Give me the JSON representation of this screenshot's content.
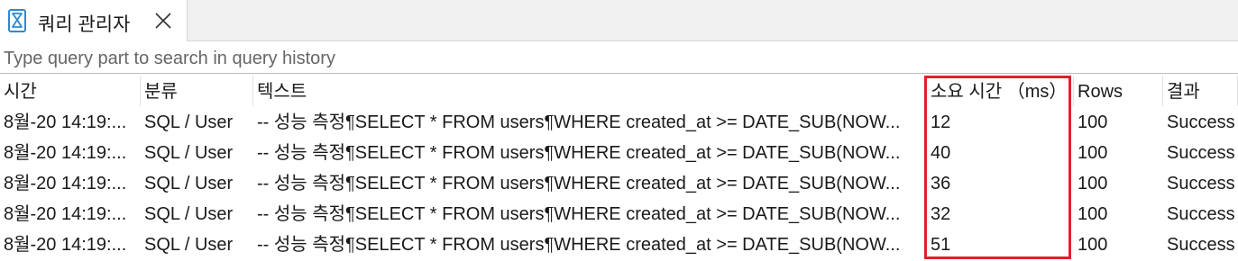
{
  "tab": {
    "title": "쿼리 관리자",
    "icon": "hourglass-icon",
    "close_icon": "close-icon"
  },
  "search": {
    "placeholder": "Type query part to search in query history",
    "value": ""
  },
  "columns": {
    "time": "시간",
    "category": "분류",
    "text": "텍스트",
    "duration": "소요 시간 （ms）",
    "rows": "Rows",
    "result": "결과"
  },
  "rows": [
    {
      "time": "8월-20 14:19:...",
      "category": "SQL / User",
      "text": "-- 성능 측정¶SELECT * FROM users¶WHERE created_at >= DATE_SUB(NOW...",
      "duration": "12",
      "rows": "100",
      "result": "Success"
    },
    {
      "time": "8월-20 14:19:...",
      "category": "SQL / User",
      "text": "-- 성능 측정¶SELECT * FROM users¶WHERE created_at >= DATE_SUB(NOW...",
      "duration": "40",
      "rows": "100",
      "result": "Success"
    },
    {
      "time": "8월-20 14:19:...",
      "category": "SQL / User",
      "text": "-- 성능 측정¶SELECT * FROM users¶WHERE created_at >= DATE_SUB(NOW...",
      "duration": "36",
      "rows": "100",
      "result": "Success"
    },
    {
      "time": "8월-20 14:19:...",
      "category": "SQL / User",
      "text": "-- 성능 측정¶SELECT * FROM users¶WHERE created_at >= DATE_SUB(NOW...",
      "duration": "32",
      "rows": "100",
      "result": "Success"
    },
    {
      "time": "8월-20 14:19:...",
      "category": "SQL / User",
      "text": "-- 성능 측정¶SELECT * FROM users¶WHERE created_at >= DATE_SUB(NOW...",
      "duration": "51",
      "rows": "100",
      "result": "Success"
    }
  ],
  "colors": {
    "highlight_border": "#e0202a",
    "icon_accent": "#2a8ad4"
  }
}
